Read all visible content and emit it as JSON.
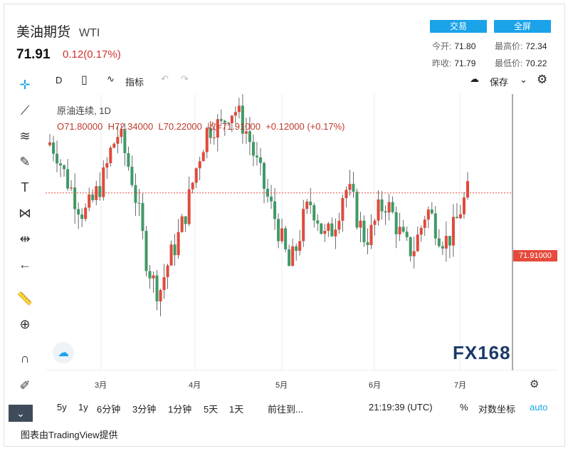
{
  "header": {
    "title": "美油期货",
    "symbol": "WTI",
    "price": "71.91",
    "change": "0.12(0.17%)"
  },
  "buttons": {
    "trade": "交易",
    "fullscreen": "全屏"
  },
  "stats": {
    "open_label": "今开:",
    "open": "71.80",
    "high_label": "最高价:",
    "high": "72.34",
    "prev_label": "昨收:",
    "prev": "71.79",
    "low_label": "最低价:",
    "low": "70.22"
  },
  "toolbar": {
    "interval": "D",
    "indicators": "指标",
    "save": "保存"
  },
  "legend": {
    "name": "原油连续, 1D",
    "o": "O71.80000",
    "h": "H72.34000",
    "l": "L70.22000",
    "c": "收=71.91000",
    "delta": "+0.12000 (+0.17%)"
  },
  "price_tag": "71.91000",
  "xaxis": [
    "3月",
    "4月",
    "5月",
    "6月",
    "7月"
  ],
  "bottom": {
    "ranges": [
      "5y",
      "1y",
      "6分钟",
      "3分钟",
      "1分钟",
      "5天",
      "1天"
    ],
    "goto": "前往到...",
    "time": "21:19:39 (UTC)",
    "pct": "%",
    "log": "对数坐标",
    "auto": "auto"
  },
  "footer": "图表由TradingView提供",
  "watermark": "FX168",
  "colors": {
    "up": "#e04a3c",
    "down": "#3f9a66",
    "accent": "#1aa3e8"
  },
  "icons": [
    "crosshair-icon",
    "trendline-icon",
    "fib-icon",
    "brush-icon",
    "text-icon",
    "pattern-icon",
    "measure-icon",
    "back-arrow-icon",
    "ruler-icon",
    "zoom-icon",
    "magnet-icon",
    "lock-icon",
    "trash-icon"
  ],
  "chart_data": {
    "type": "candlestick",
    "y_current": 71.91
  }
}
